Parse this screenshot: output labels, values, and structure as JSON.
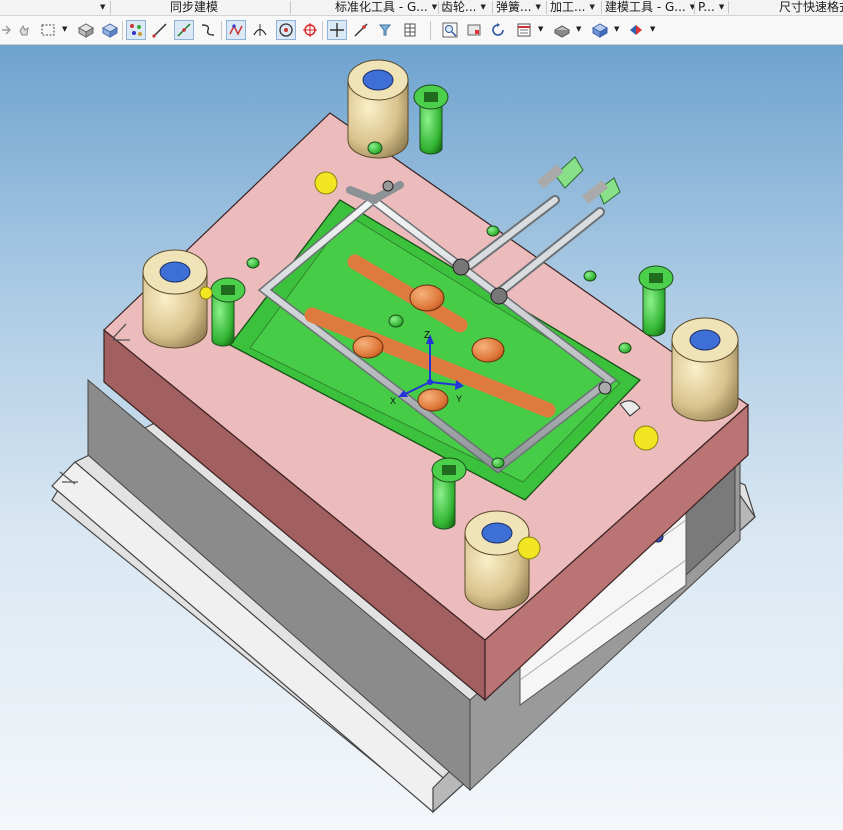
{
  "ribbon_groups": [
    {
      "label": "",
      "has_dropdown": true
    },
    {
      "label": "同步建模",
      "has_dropdown": false
    },
    {
      "label": "标准化工具 - G...",
      "has_dropdown": true
    },
    {
      "label": "齿轮...",
      "has_dropdown": true
    },
    {
      "label": "弹簧...",
      "has_dropdown": true
    },
    {
      "label": "加工...",
      "has_dropdown": true
    },
    {
      "label": "建模工具 - G...",
      "has_dropdown": true
    },
    {
      "label": "P...",
      "has_dropdown": true
    },
    {
      "label": "尺寸快速格式",
      "has_dropdown": false
    }
  ],
  "toolbar_icons": [
    "snap-pointer-icon",
    "select-rectangle-icon",
    "shaded-face-icon",
    "solid-body-icon",
    "point-cloud-icon",
    "line-select-icon",
    "edge-select-icon",
    "curve-icon",
    "vertex-snap-icon",
    "tangent-snap-icon",
    "center-point-icon",
    "quadrant-point-icon",
    "intersection-icon",
    "edge-point-icon",
    "object-filter-icon",
    "grid-icon",
    "zoom-fit-icon",
    "view-orient-icon",
    "rotate-view-icon",
    "layer-settings-icon",
    "display-style-icon",
    "shading-icon",
    "triad-display-icon"
  ],
  "viewport": {
    "triad_labels": {
      "z": "Z",
      "x": "X",
      "y": "Y"
    }
  },
  "colors": {
    "plate_top": "#ecbcbc",
    "plate_side": "#a56060",
    "core_insert": "#3cc13c",
    "leader_bushing": "#d8c495",
    "bolt": "#3bb43b",
    "cooling_pipe": "#cfd3d6",
    "slider_orange": "#df7a3e",
    "marker_yellow": "#f2e521",
    "triad_blue": "#2335d9"
  }
}
